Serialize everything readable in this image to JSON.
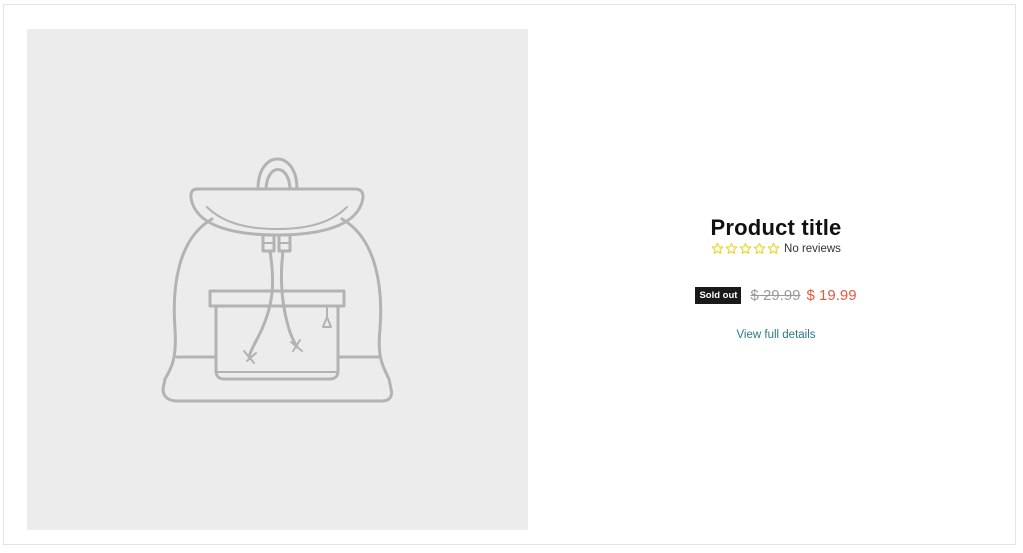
{
  "product": {
    "title": "Product title",
    "reviews_label": "No reviews",
    "rating_stars": 0,
    "rating_max": 5,
    "badge_label": "Sold out",
    "compare_price": "$ 29.99",
    "sale_price": "$ 19.99",
    "details_link": "View full details",
    "image_icon": "backpack-placeholder-icon"
  },
  "colors": {
    "placeholder_bg": "#ececec",
    "sale_price": "#e05a3f",
    "link": "#2a7a86",
    "star": "#e7d93a",
    "badge_bg": "#1a1a1a"
  }
}
